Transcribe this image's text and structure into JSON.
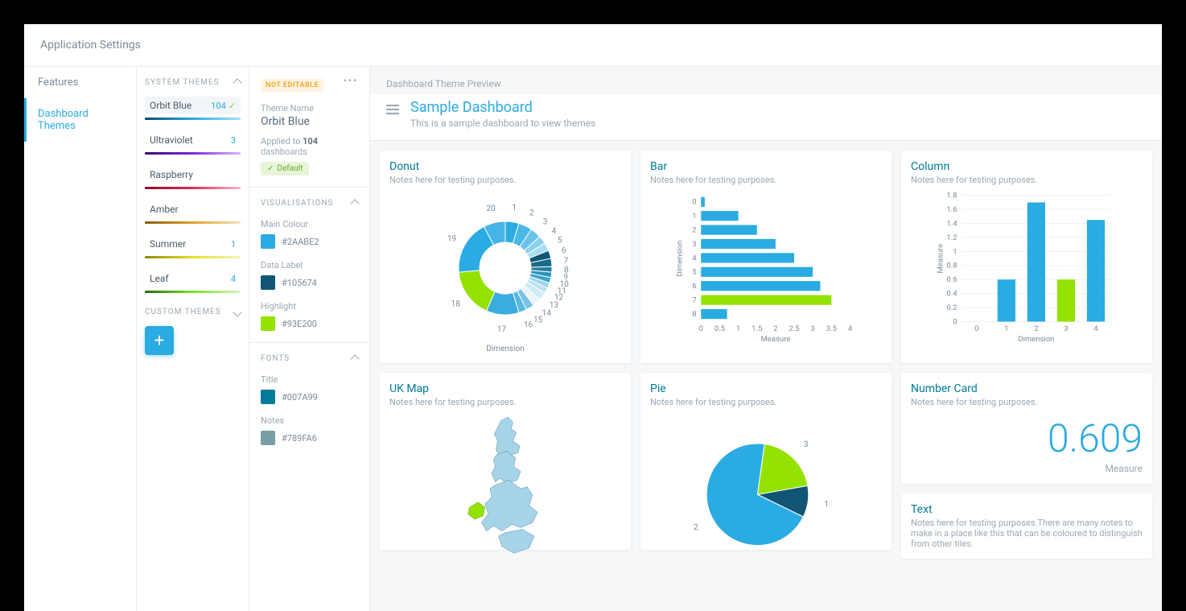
{
  "header": {
    "title": "Application Settings"
  },
  "nav": {
    "features": "Features",
    "dashboard_themes": "Dashboard Themes"
  },
  "themes": {
    "system_header": "SYSTEM THEMES",
    "custom_header": "CUSTOM THEMES",
    "items": [
      {
        "name": "Orbit Blue",
        "count": 104,
        "selected": true,
        "default": true,
        "gradient": "linear-gradient(90deg,#0a4a6e,#2aabe2,#a8dff5)"
      },
      {
        "name": "Ultraviolet",
        "count": 3,
        "gradient": "linear-gradient(90deg,#3a0a6e,#7a2ae2,#d8b8f5)"
      },
      {
        "name": "Raspberry",
        "count": "",
        "gradient": "linear-gradient(90deg,#8a0a2e,#e22a5a,#f5b8c8)"
      },
      {
        "name": "Amber",
        "count": "",
        "gradient": "linear-gradient(90deg,#8a5a0a,#e2a22a,#f5e0b8)"
      },
      {
        "name": "Summer",
        "count": 1,
        "gradient": "linear-gradient(90deg,#8a8a0a,#e2e22a,#f5f5b8)"
      },
      {
        "name": "Leaf",
        "count": 4,
        "gradient": "linear-gradient(90deg,#2a6e0a,#7ae22a,#d8f5b8)"
      }
    ]
  },
  "details": {
    "not_editable": "NOT EDITABLE",
    "theme_name_lbl": "Theme Name",
    "theme_name": "Orbit Blue",
    "applied_prefix": "Applied to ",
    "applied_count": "104",
    "applied_suffix": " dashboards",
    "default_lbl": "Default",
    "vis_header": "VISUALISATIONS",
    "vis": {
      "main_lbl": "Main Colour",
      "main_hex": "#2AABE2",
      "data_lbl": "Data Label",
      "data_hex": "#105674",
      "high_lbl": "Highlight",
      "high_hex": "#93E200"
    },
    "fonts_header": "FONTS",
    "fonts": {
      "title_lbl": "Title",
      "title_hex": "#007A99",
      "notes_lbl": "Notes",
      "notes_hex": "#789FA6"
    }
  },
  "preview": {
    "header": "Dashboard Theme Preview",
    "title": "Sample Dashboard",
    "subtitle": "This is a sample dashboard to view themes"
  },
  "tiles": {
    "donut": {
      "title": "Donut",
      "notes": "Notes here for testing purposes.",
      "xlabel": "Dimension"
    },
    "bar": {
      "title": "Bar",
      "notes": "Notes here for testing purposes.",
      "xlabel": "Measure",
      "ylabel": "Dimension"
    },
    "column": {
      "title": "Column",
      "notes": "Notes here for testing purposes.",
      "xlabel": "Dimension",
      "ylabel": "Measure"
    },
    "map": {
      "title": "UK Map",
      "notes": "Notes here for testing purposes."
    },
    "pie": {
      "title": "Pie",
      "notes": "Notes here for testing purposes."
    },
    "number": {
      "title": "Number Card",
      "notes": "Notes here for testing purposes.",
      "value": "0.609",
      "label": "Measure"
    },
    "text": {
      "title": "Text",
      "notes": "Notes here for testing purposes.There are many notes to make in a place like this that can be coloured to distinguish from other tiles."
    }
  },
  "chart_data": [
    {
      "type": "donut",
      "tile": "donut",
      "categories": [
        "1",
        "2",
        "3",
        "4",
        "5",
        "6",
        "7",
        "8",
        "9",
        "10",
        "11",
        "12",
        "13",
        "14",
        "15",
        "16",
        "17",
        "18",
        "19",
        "20"
      ],
      "values": [
        5,
        5,
        4,
        3,
        3,
        3,
        3,
        2,
        2,
        2,
        2,
        2,
        3,
        3,
        3,
        3,
        12,
        18,
        20,
        8
      ],
      "xlabel": "Dimension"
    },
    {
      "type": "bar",
      "tile": "bar",
      "orientation": "horizontal",
      "categories": [
        "0",
        "1",
        "2",
        "3",
        "4",
        "5",
        "6",
        "7",
        "8"
      ],
      "values": [
        0.1,
        1.0,
        1.5,
        2.0,
        2.5,
        3.0,
        3.2,
        3.5,
        0.7
      ],
      "highlight_index": 7,
      "xlabel": "Measure",
      "ylabel": "Dimension",
      "xlim": [
        0,
        4
      ],
      "xticks": [
        0,
        0.5,
        1,
        1.5,
        2,
        2.5,
        3,
        3.5,
        4
      ]
    },
    {
      "type": "bar",
      "tile": "column",
      "orientation": "vertical",
      "categories": [
        "0",
        "1",
        "2",
        "3",
        "4"
      ],
      "values": [
        0,
        0.6,
        1.7,
        0.6,
        1.45
      ],
      "highlight_index": 3,
      "xlabel": "Dimension",
      "ylabel": "Measure",
      "ylim": [
        0,
        1.8
      ],
      "yticks": [
        0,
        0.2,
        0.4,
        0.6,
        0.8,
        1,
        1.2,
        1.4,
        1.6,
        1.8
      ]
    },
    {
      "type": "pie",
      "tile": "pie",
      "categories": [
        "1",
        "2",
        "3"
      ],
      "values": [
        10,
        70,
        20
      ]
    }
  ]
}
